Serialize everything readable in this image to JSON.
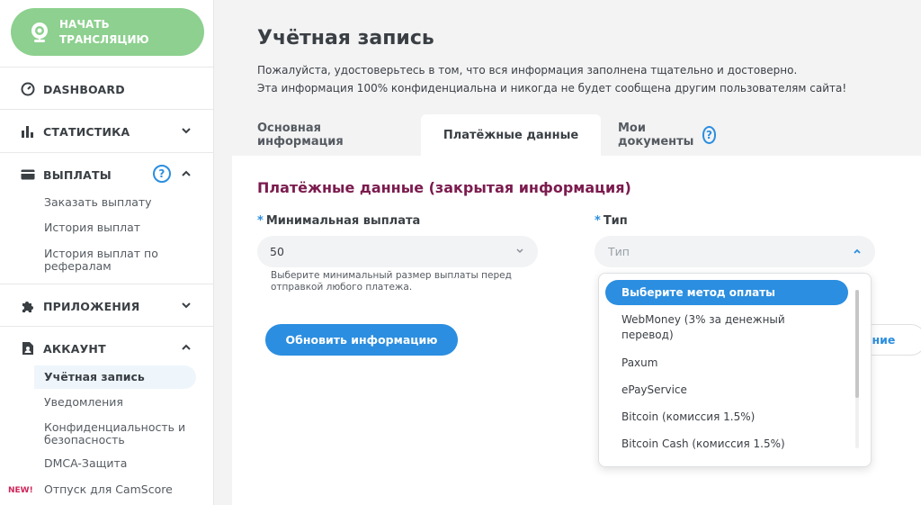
{
  "sidebar": {
    "stream_button": "НАЧАТЬ ТРАНСЛЯЦИЮ",
    "dashboard": "DASHBOARD",
    "statistics": "СТАТИСТИКА",
    "payouts": {
      "label": "ВЫПЛАТЫ",
      "help": "?",
      "items": [
        "Заказать выплату",
        "История выплат",
        "История выплат по рефералам"
      ]
    },
    "apps": "ПРИЛОЖЕНИЯ",
    "account": {
      "label": "АККАУНТ",
      "items": [
        "Учётная запись",
        "Уведомления",
        "Конфиденциальность и безопасность",
        "DMCA-Защита",
        "Отпуск для CamScore"
      ]
    },
    "new_badge": "NEW!"
  },
  "main": {
    "title": "Учётная запись",
    "desc_line1": "Пожалуйста, удостоверьтесь в том, что вся информация заполнена тщательно и достоверно.",
    "desc_line2": "Эта информация 100% конфиденциальна и никогда не будет сообщена другим пользователям сайта!",
    "tabs": [
      {
        "label": "Основная информация"
      },
      {
        "label": "Платёжные данные"
      },
      {
        "label": "Мои документы"
      }
    ],
    "tab_help": "?",
    "section_title": "Платёжные данные (закрытая информация)",
    "min_payout": {
      "star": "*",
      "label": "Минимальная выплата",
      "value": "50",
      "hint": "Выберите минимальный размер выплаты перед отправкой любого платежа."
    },
    "type": {
      "star": "*",
      "label": "Тип",
      "placeholder": "Тип"
    },
    "update_button": "Обновить информацию",
    "secondary_button_partial": "ение",
    "dropdown": {
      "options": [
        "Выберите метод оплаты",
        "WebMoney (3% за денежный перевод)",
        "Paxum",
        "ePayService",
        "Bitcoin (комиссия 1.5%)",
        "Bitcoin Cash (комиссия 1.5%)"
      ]
    }
  },
  "colors": {
    "accent": "#2b8ee0",
    "stream_green": "#8dd08f",
    "section_title": "#7b1b4e",
    "new_badge": "#d0245a"
  }
}
